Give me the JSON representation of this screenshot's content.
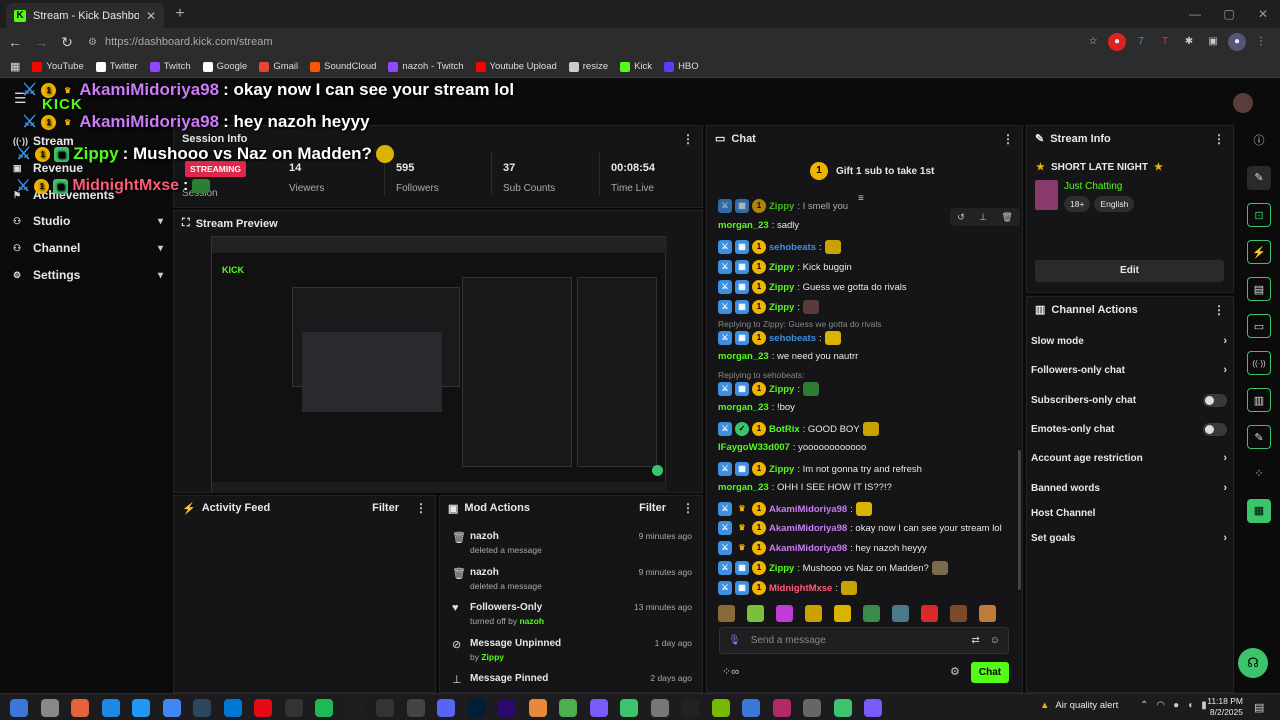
{
  "browser": {
    "tab_title": "Stream - Kick Dashboard",
    "url": "https://dashboard.kick.com/stream",
    "bookmarks": [
      {
        "label": "YouTube",
        "color": "#ff0000"
      },
      {
        "label": "Twitter",
        "color": "#ffffff"
      },
      {
        "label": "Twitch",
        "color": "#9146ff"
      },
      {
        "label": "Google",
        "color": "#ffffff"
      },
      {
        "label": "Gmail",
        "color": "#ea4335"
      },
      {
        "label": "SoundCloud",
        "color": "#ff5500"
      },
      {
        "label": "nazoh - Twitch",
        "color": "#9146ff"
      },
      {
        "label": "Youtube Upload",
        "color": "#ff0000"
      },
      {
        "label": "resize",
        "color": "#cccccc"
      },
      {
        "label": "Kick",
        "color": "#53fc18"
      },
      {
        "label": "HBO",
        "color": "#5a3cff"
      }
    ]
  },
  "overlay": {
    "logo": "KICK",
    "lines": [
      {
        "user": "AkamiMidoriya98",
        "msg": ": okay now I can see your stream lol",
        "color": "#c97cf5"
      },
      {
        "user": "AkamiMidoriya98",
        "msg": ": hey nazoh heyyy",
        "color": "#c97cf5"
      },
      {
        "user": "Zippy",
        "msg": ": Mushooo vs Naz on Madden?",
        "color": "#53fc18"
      },
      {
        "user": "MidnightMxse",
        "msg": ":",
        "color": "#ff5a7a"
      }
    ]
  },
  "sidebar": {
    "items": [
      {
        "label": "Stream",
        "icon": "broadcast-icon"
      },
      {
        "label": "Revenue",
        "icon": "revenue-icon"
      },
      {
        "label": "Achievements",
        "icon": "trophy-icon"
      },
      {
        "label": "Studio",
        "icon": "studio-icon"
      },
      {
        "label": "Channel",
        "icon": "channel-icon"
      },
      {
        "label": "Settings",
        "icon": "gear-icon"
      }
    ]
  },
  "session": {
    "title": "Session Info",
    "status": "STREAMING",
    "session_label": "Session",
    "stats": [
      {
        "value": "14",
        "label": "Viewers"
      },
      {
        "value": "595",
        "label": "Followers"
      },
      {
        "value": "37",
        "label": "Sub Counts"
      },
      {
        "value": "00:08:54",
        "label": "Time Live"
      }
    ]
  },
  "preview": {
    "title": "Stream Preview"
  },
  "activity": {
    "title": "Activity Feed",
    "filter": "Filter"
  },
  "mod_actions": {
    "title": "Mod Actions",
    "filter": "Filter",
    "items": [
      {
        "title": "nazoh",
        "sub": "deleted a message",
        "time": "9 minutes ago",
        "icon": "trash-icon"
      },
      {
        "title": "nazoh",
        "sub": "deleted a message",
        "time": "9 minutes ago",
        "icon": "trash-icon"
      },
      {
        "title": "Followers-Only",
        "sub": "turned off by",
        "by": "nazoh",
        "time": "13 minutes ago",
        "icon": "heart-icon"
      },
      {
        "title": "Message Unpinned",
        "sub": "by",
        "by": "Zippy",
        "time": "1 day ago",
        "icon": "unpin-icon"
      },
      {
        "title": "Message Pinned",
        "sub": "",
        "time": "2 days ago",
        "icon": "pin-icon"
      }
    ]
  },
  "chat": {
    "title": "Chat",
    "gift": "Gift 1 sub to take 1st",
    "gift_count": "1",
    "placeholder": "Send a message",
    "send": "Chat",
    "messages": [
      {
        "user": "Zippy",
        "text": ": I smell you",
        "color": "#53fc18"
      },
      {
        "user": "morgan_23",
        "text": ": sadly",
        "color": "#53fc18"
      },
      {
        "user": "sehobeats",
        "text": ":",
        "color": "#3d8fe0"
      },
      {
        "user": "Zippy",
        "text": ": Kick buggin",
        "color": "#53fc18"
      },
      {
        "user": "Zippy",
        "text": ": Guess we gotta do rivals",
        "color": "#53fc18"
      },
      {
        "user": "Zippy",
        "text": ":",
        "color": "#53fc18"
      },
      {
        "user": "sehobeats",
        "text": ":",
        "color": "#3d8fe0",
        "reply": "Replying to Zippy: Guess we gotta do rivals"
      },
      {
        "user": "morgan_23",
        "text": ": we need you nautrr",
        "color": "#53fc18"
      },
      {
        "user": "Zippy",
        "text": ":",
        "color": "#53fc18",
        "reply": "Replying to sehobeats:"
      },
      {
        "user": "morgan_23",
        "text": ": !boy",
        "color": "#53fc18"
      },
      {
        "user": "BotRix",
        "text": ": GOOD BOY",
        "color": "#53fc18"
      },
      {
        "user": "IFaygoW33d007",
        "text": ": yoooooooooooo",
        "color": "#53fc18"
      },
      {
        "user": "Zippy",
        "text": ": Im not gonna try and refresh",
        "color": "#53fc18"
      },
      {
        "user": "morgan_23",
        "text": ": OHH I SEE HOW IT IS??!?",
        "color": "#53fc18"
      },
      {
        "user": "AkamiMidoriya98",
        "text": ":",
        "color": "#c97cf5"
      },
      {
        "user": "AkamiMidoriya98",
        "text": ": okay now I can see your stream lol",
        "color": "#c97cf5"
      },
      {
        "user": "AkamiMidoriya98",
        "text": ": hey nazoh heyyy",
        "color": "#c97cf5"
      },
      {
        "user": "Zippy",
        "text": ": Mushooo vs Naz on Madden?",
        "color": "#53fc18"
      },
      {
        "user": "MidnightMxse",
        "text": ":",
        "color": "#ff5a7a"
      }
    ]
  },
  "stream_info": {
    "title": "Stream Info",
    "stream_title": "SHORT LATE NIGHT",
    "category": "Just Chatting",
    "tags": [
      "18+",
      "English"
    ],
    "edit": "Edit"
  },
  "channel_actions": {
    "title": "Channel Actions",
    "items": [
      {
        "label": "Slow mode",
        "type": "arrow"
      },
      {
        "label": "Followers-only chat",
        "type": "arrow"
      },
      {
        "label": "Subscribers-only chat",
        "type": "toggle"
      },
      {
        "label": "Emotes-only chat",
        "type": "toggle"
      },
      {
        "label": "Account age restriction",
        "type": "arrow"
      },
      {
        "label": "Banned words",
        "type": "arrow"
      },
      {
        "label": "Host Channel",
        "type": "none"
      },
      {
        "label": "Set goals",
        "type": "arrow"
      }
    ]
  },
  "taskbar": {
    "weather": "Air quality alert",
    "time": "11:18 PM",
    "date": "8/2/2025"
  }
}
